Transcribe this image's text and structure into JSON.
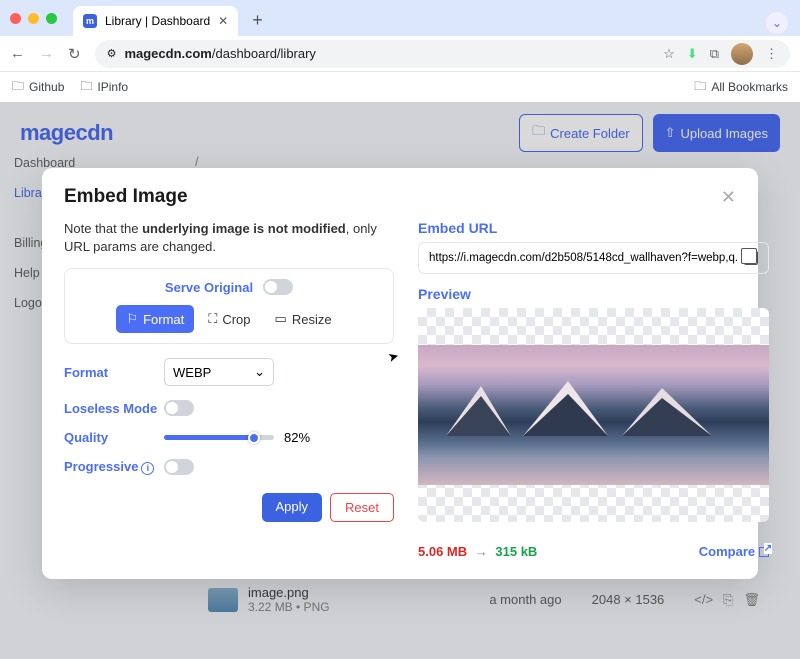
{
  "browser": {
    "tab_title": "Library | Dashboard",
    "url_display_prefix": "magecdn.com",
    "url_display_path": "/dashboard/library",
    "bookmarks": {
      "github": "Github",
      "ipinfo": "IPinfo",
      "all": "All Bookmarks"
    }
  },
  "app": {
    "logo": "magecdn",
    "create_folder": "Create Folder",
    "upload": "Upload Images",
    "breadcrumb_sep": "/",
    "sidebar": {
      "dashboard": "Dashboard",
      "library": "Library",
      "billing": "Billing",
      "help": "Help",
      "logout": "Logout"
    }
  },
  "modal": {
    "title": "Embed Image",
    "note_prefix": "Note that the ",
    "note_bold": "underlying image is not modified",
    "note_suffix": ", only URL params are changed.",
    "serve_original": "Serve Original",
    "tabs": {
      "format": "Format",
      "crop": "Crop",
      "resize": "Resize"
    },
    "form": {
      "format_label": "Format",
      "format_value": "WEBP",
      "lossless_label": "Loseless Mode",
      "quality_label": "Quality",
      "quality_value": "82%",
      "progressive_label": "Progressive"
    },
    "apply": "Apply",
    "reset": "Reset",
    "embed_url_label": "Embed URL",
    "embed_url_value": "https://i.magecdn.com/d2b508/5148cd_wallhaven?f=webp,q.",
    "preview_label": "Preview",
    "size_before": "5.06 MB",
    "size_after": "315 kB",
    "compare": "Compare"
  },
  "file": {
    "name": "image.png",
    "meta": "3.22 MB • PNG",
    "age": "a month ago",
    "dims": "2048 × 1536"
  }
}
